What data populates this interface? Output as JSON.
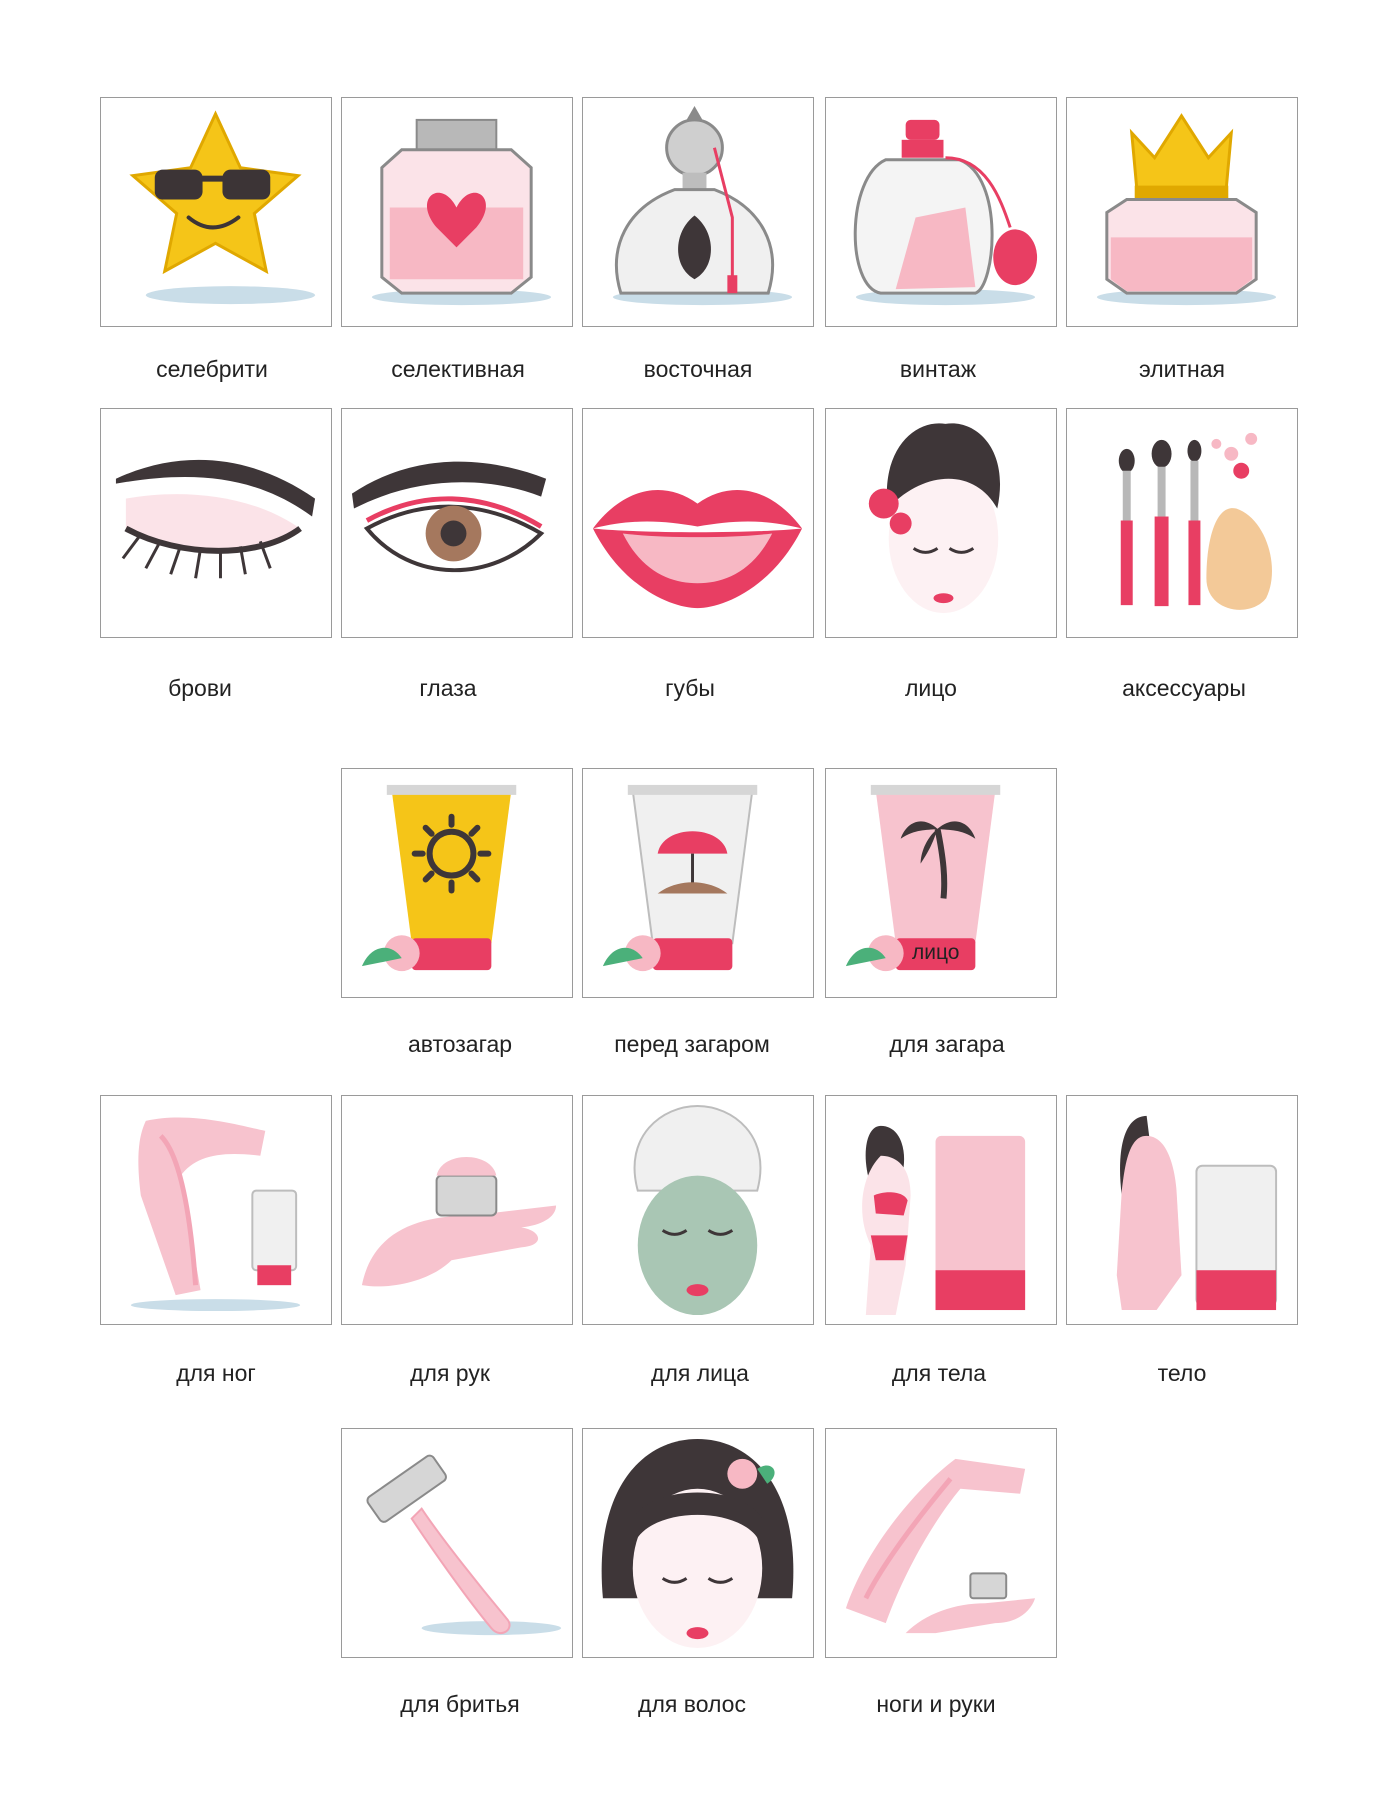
{
  "colors": {
    "pink": "#e83e63",
    "light_pink": "#f7c3ce",
    "yellow": "#f5c518",
    "hair": "#3e3638",
    "border": "#9a9a9a"
  },
  "categories": [
    {
      "id": "celebrity",
      "label": "селебрити",
      "icon": "star-sunglasses-icon"
    },
    {
      "id": "selective",
      "label": "селективная",
      "icon": "heart-perfume-icon"
    },
    {
      "id": "oriental",
      "label": "восточная",
      "icon": "oriental-perfume-icon"
    },
    {
      "id": "vintage",
      "label": "винтаж",
      "icon": "vintage-atomizer-icon"
    },
    {
      "id": "elite",
      "label": "элитная",
      "icon": "crown-perfume-icon"
    },
    {
      "id": "brows",
      "label": "брови",
      "icon": "eyebrow-icon"
    },
    {
      "id": "eyes",
      "label": "глаза",
      "icon": "eye-icon"
    },
    {
      "id": "lips",
      "label": "губы",
      "icon": "lips-icon"
    },
    {
      "id": "face",
      "label": "лицо",
      "icon": "face-rose-icon"
    },
    {
      "id": "accessories",
      "label": "аксессуары",
      "icon": "brushes-sponge-icon"
    },
    {
      "id": "self-tan",
      "label": "автозагар",
      "icon": "sun-tube-icon"
    },
    {
      "id": "pre-tan",
      "label": "перед загаром",
      "icon": "umbrella-tube-icon"
    },
    {
      "id": "tan",
      "label": "для загара",
      "icon": "palm-tube-icon",
      "overlay_text": "лицо"
    },
    {
      "id": "legs",
      "label": "для ног",
      "icon": "leg-tube-icon"
    },
    {
      "id": "hands",
      "label": "для рук",
      "icon": "hand-cream-icon"
    },
    {
      "id": "face-care",
      "label": "для лица",
      "icon": "face-mask-icon"
    },
    {
      "id": "body-care",
      "label": "для тела",
      "icon": "woman-bikini-tube-icon"
    },
    {
      "id": "body",
      "label": "тело",
      "icon": "body-tube-icon"
    },
    {
      "id": "shaving",
      "label": "для бритья",
      "icon": "razor-icon"
    },
    {
      "id": "hair",
      "label": "для волос",
      "icon": "hair-woman-icon"
    },
    {
      "id": "legs-hands",
      "label": "ноги и руки",
      "icon": "leg-hand-cream-icon"
    }
  ]
}
